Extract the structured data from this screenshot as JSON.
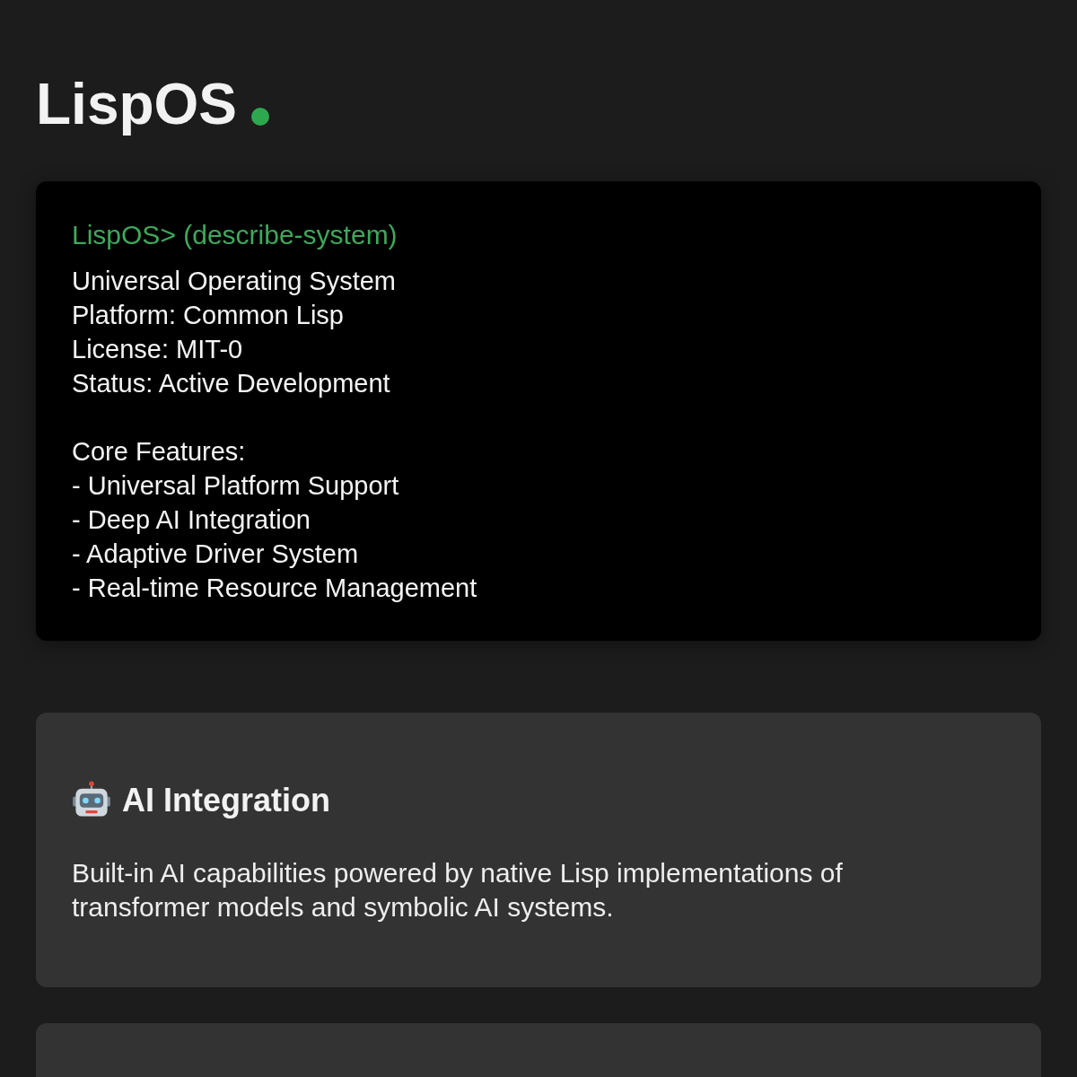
{
  "title": "LispOS",
  "online": true,
  "terminal": {
    "prompt": "LispOS> (describe-system)",
    "info": [
      "Universal Operating System",
      "Platform: Common Lisp",
      "License: MIT-0",
      "Status: Active Development"
    ],
    "features_heading": "Core Features:",
    "features": [
      "- Universal Platform Support",
      "- Deep AI Integration",
      "- Adaptive Driver System",
      "- Real-time Resource Management"
    ]
  },
  "cards": [
    {
      "kind": "feature",
      "title": "AI Integration",
      "description": "Built-in AI capabilities powered by native Lisp implementations of transformer models and symbolic AI systems."
    },
    {
      "kind": "blank"
    }
  ]
}
